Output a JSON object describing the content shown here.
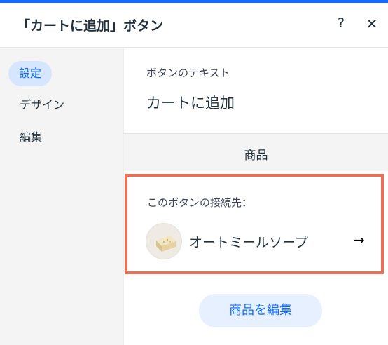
{
  "header": {
    "title": "「カートに追加」ボタン",
    "help_icon": "?",
    "close_icon": "✕"
  },
  "sidebar": {
    "items": [
      {
        "label": "設定",
        "active": true
      },
      {
        "label": "デザイン",
        "active": false
      },
      {
        "label": "編集",
        "active": false
      }
    ]
  },
  "content": {
    "button_text_label": "ボタンのテキスト",
    "button_text_value": "カートに追加",
    "section_title": "商品",
    "connect_label": "このボタンの接続先：",
    "product_name": "オートミールソープ",
    "arrow_icon": "→",
    "edit_button_label": "商品を編集"
  },
  "colors": {
    "accent": "#116dff",
    "highlight_border": "#ec6f55"
  }
}
